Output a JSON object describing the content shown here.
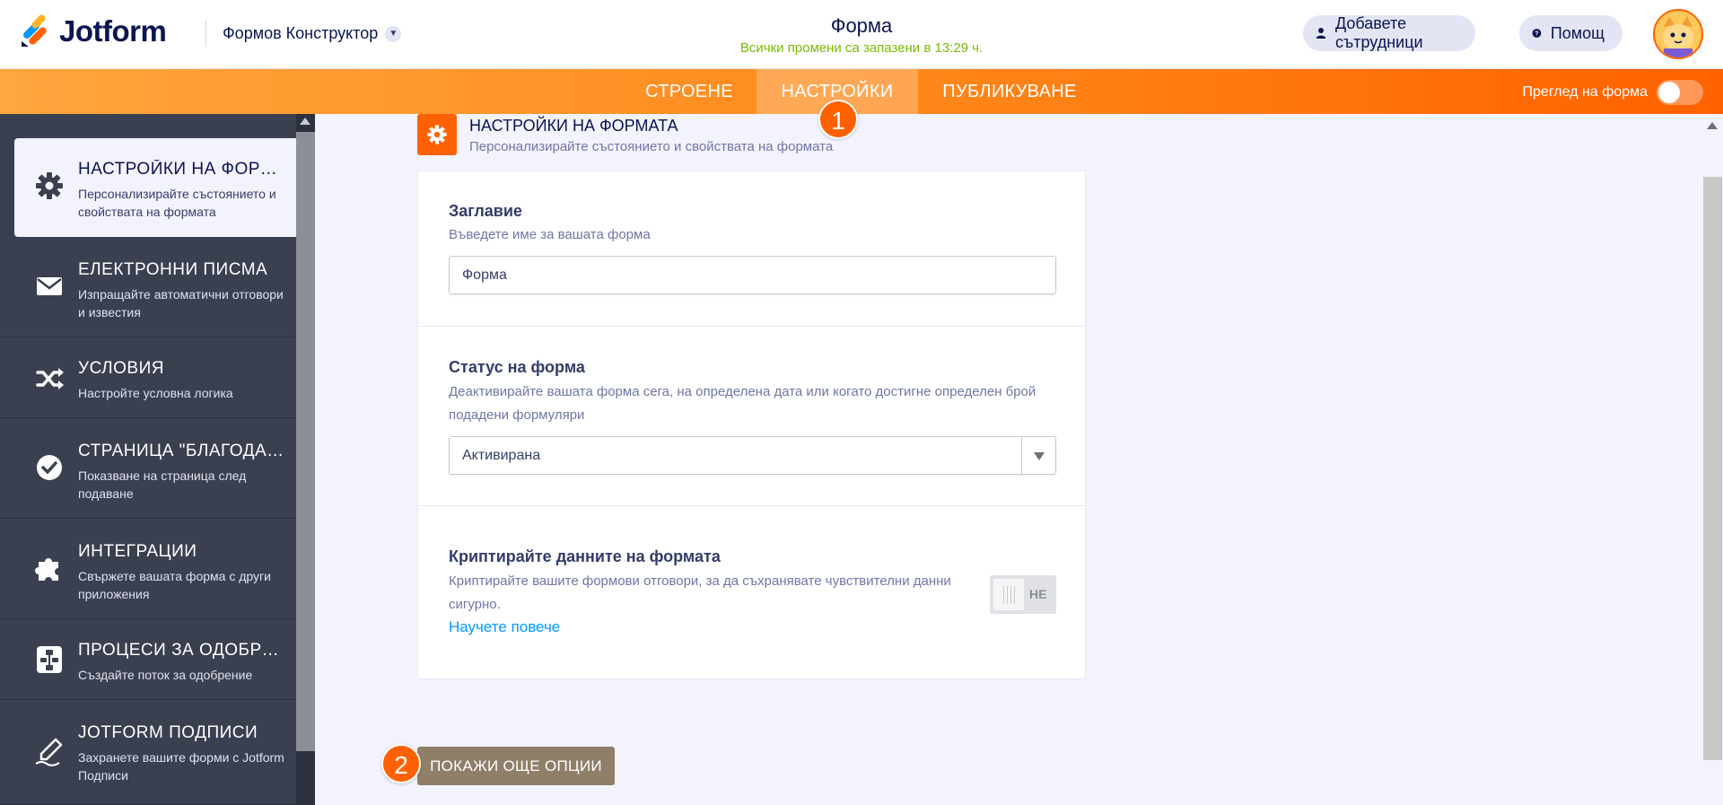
{
  "header": {
    "logo_text": "Jotform",
    "builder_label": "Формов Конструктор",
    "form_title": "Форма",
    "saved_status": "Всички промени са запазени в 13:29 ч.",
    "collaborators_label": "Добавете сътрудници",
    "help_label": "Помощ"
  },
  "nav": {
    "tabs": [
      {
        "label": "СТРОЕНЕ"
      },
      {
        "label": "НАСТРОЙКИ"
      },
      {
        "label": "ПУБЛИКУВАНЕ"
      }
    ],
    "active_tab": "НАСТРОЙКИ",
    "preview_label": "Преглед на форма",
    "preview_on": false
  },
  "annotations": {
    "badge_1": "1",
    "badge_2": "2"
  },
  "sidebar": {
    "items": [
      {
        "title": "НАСТРОЙКИ НА ФОРМ...",
        "desc": "Персонализирайте състоянието и свойствата на формата",
        "icon": "gear-icon",
        "active": true
      },
      {
        "title": "ЕЛЕКТРОННИ ПИСМА",
        "desc": "Изпращайте автоматични отговори и известия",
        "icon": "envelope-icon"
      },
      {
        "title": "УСЛОВИЯ",
        "desc": "Настройте условна логика",
        "icon": "shuffle-icon"
      },
      {
        "title": "СТРАНИЦА \"БЛАГОДАРЯ\"",
        "desc": "Показване на страница след подаване",
        "icon": "check-circle-icon"
      },
      {
        "title": "ИНТЕГРАЦИИ",
        "desc": "Свържете вашата форма с други приложения",
        "icon": "puzzle-icon"
      },
      {
        "title": "ПРОЦЕСИ ЗА ОДОБРЕН...",
        "desc": "Създайте поток за одобрение",
        "icon": "flow-icon"
      },
      {
        "title": "JOTFORM ПОДПИСИ",
        "desc": "Захранете вашите форми с Jotform Подписи",
        "icon": "pen-icon"
      }
    ]
  },
  "section": {
    "title": "НАСТРОЙКИ НА ФОРМАТА",
    "subtitle": "Персонализирайте състоянието и свойствата на формата"
  },
  "fields": {
    "title": {
      "label": "Заглавие",
      "desc": "Въведете име за вашата форма",
      "value": "Форма"
    },
    "status": {
      "label": "Статус на форма",
      "desc": "Деактивирайте вашата форма сега, на определена дата или когато достигне определен брой подадени формуляри",
      "value": "Активирана"
    },
    "encrypt": {
      "label": "Криптирайте данните на формата",
      "desc": "Криптирайте вашите формови отговори, за да съхранявате чувствителни данни сигурно.",
      "link": "Научете повече",
      "toggle_label": "НЕ",
      "enabled": false
    }
  },
  "more_options_label": "ПОКАЖИ ОЩЕ ОПЦИИ",
  "colors": {
    "accent": "#ff6100",
    "nav_gradient_start": "#ffa63e",
    "sidebar_bg": "#3a4050",
    "saved_green": "#78bb07",
    "link_blue": "#0099ff",
    "more_button": "#8f7f69"
  }
}
